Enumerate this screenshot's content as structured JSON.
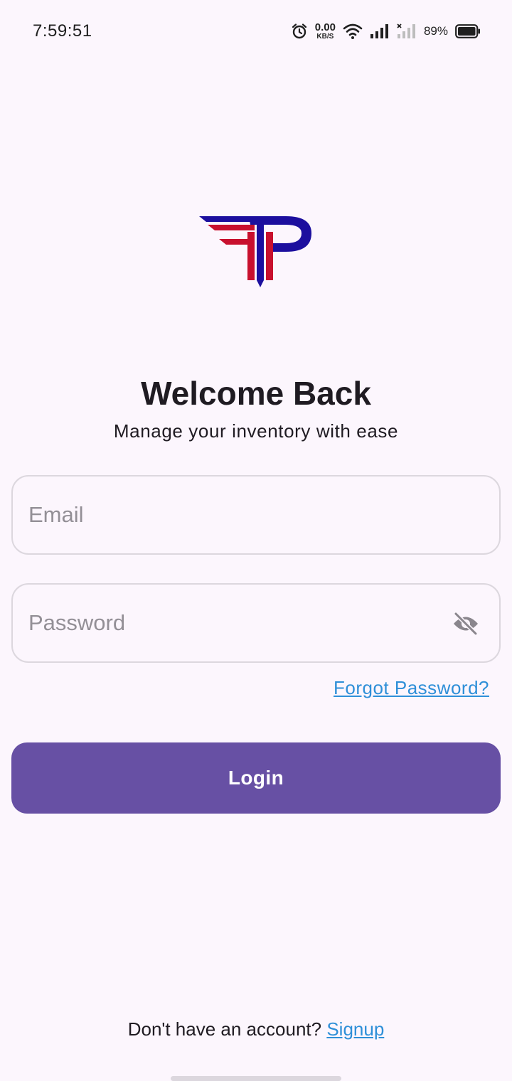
{
  "status_bar": {
    "time": "7:59:51",
    "net_speed_value": "0.00",
    "net_speed_unit": "KB/S",
    "battery_percent": "89%",
    "icons": [
      "alarm-icon",
      "wifi-icon",
      "cell-signal-icon",
      "cell-signal-off-icon",
      "battery-icon"
    ]
  },
  "header": {
    "title": "Welcome Back",
    "subtitle": "Manage your inventory with ease"
  },
  "form": {
    "email": {
      "placeholder": "Email",
      "value": ""
    },
    "password": {
      "placeholder": "Password",
      "value": "",
      "toggle_icon": "eye-off-icon"
    },
    "forgot_label": "Forgot Password?",
    "login_label": "Login"
  },
  "footer": {
    "prompt": "Don't have an account?",
    "signup_label": "Signup"
  },
  "colors": {
    "background": "#fcf6fd",
    "primary": "#6750a4",
    "link": "#2e8fd8",
    "logo_blue": "#1c0f9e",
    "logo_red": "#c8102e"
  }
}
